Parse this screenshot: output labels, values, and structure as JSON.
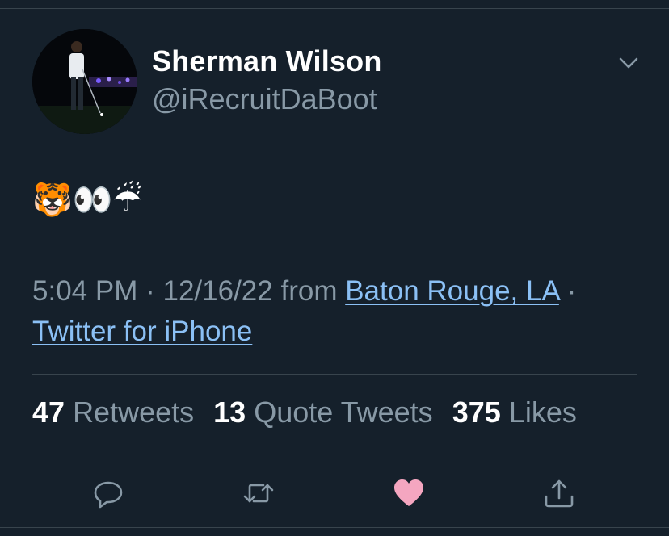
{
  "tweet": {
    "author_name": "Sherman Wilson",
    "author_handle": "@iRecruitDaBoot",
    "text": "🐯👀☔",
    "time": "5:04 PM",
    "date": "12/16/22",
    "from_label": "from",
    "location": "Baton Rouge, LA",
    "source": "Twitter for iPhone",
    "separator": "·"
  },
  "stats": {
    "retweets_count": "47",
    "retweets_label": "Retweets",
    "quotes_count": "13",
    "quotes_label": "Quote Tweets",
    "likes_count": "375",
    "likes_label": "Likes"
  },
  "actions": [
    {
      "icon": "reply-icon"
    },
    {
      "icon": "retweet-icon"
    },
    {
      "icon": "heart-icon",
      "color": "#f4a6c0"
    },
    {
      "icon": "share-icon"
    }
  ],
  "colors": {
    "background": "#15202b",
    "secondary_text": "#8899a6",
    "link": "#8bc0f5",
    "divider": "#38444d",
    "liked": "#f4a6c0"
  }
}
